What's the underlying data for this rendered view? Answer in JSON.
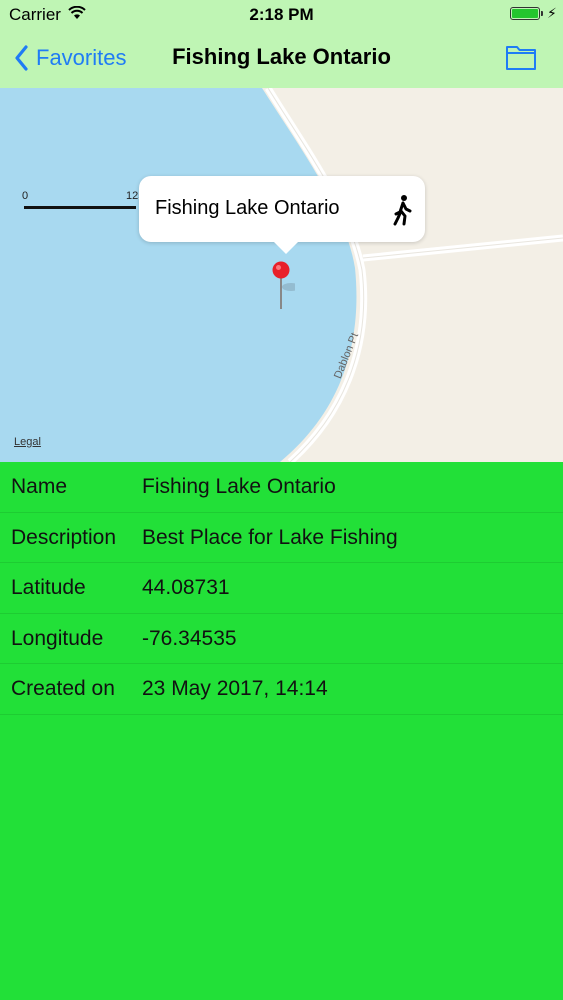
{
  "status_bar": {
    "carrier": "Carrier",
    "time": "2:18 PM",
    "battery_level": 1.0,
    "icons": [
      "wifi-icon",
      "battery-icon",
      "charging-bolt-icon"
    ]
  },
  "nav": {
    "back_label": "Favorites",
    "title": "Fishing Lake Ontario",
    "right_icon": "folder-icon"
  },
  "map": {
    "scale_zero": "0",
    "scale_distance": "125 m",
    "callout_title": "Fishing Lake Ontario",
    "callout_icon": "walking-person-icon",
    "road_label": "Dablon Pt",
    "legal_label": "Legal",
    "pin_icon": "map-pin-icon"
  },
  "details": {
    "rows": [
      {
        "label": "Name",
        "value": "Fishing Lake Ontario"
      },
      {
        "label": "Description",
        "value": "Best Place for Lake Fishing"
      },
      {
        "label": "Latitude",
        "value": "44.08731"
      },
      {
        "label": "Longitude",
        "value": "-76.34535"
      },
      {
        "label": "Created on",
        "value": "23 May 2017, 14:14"
      }
    ]
  },
  "colors": {
    "nav_background": "#bff5b4",
    "accent": "#1f7cf5",
    "content_background": "#22e038",
    "water": "#a8d9f0",
    "land": "#f3efe6",
    "pin": "#e8202a"
  }
}
